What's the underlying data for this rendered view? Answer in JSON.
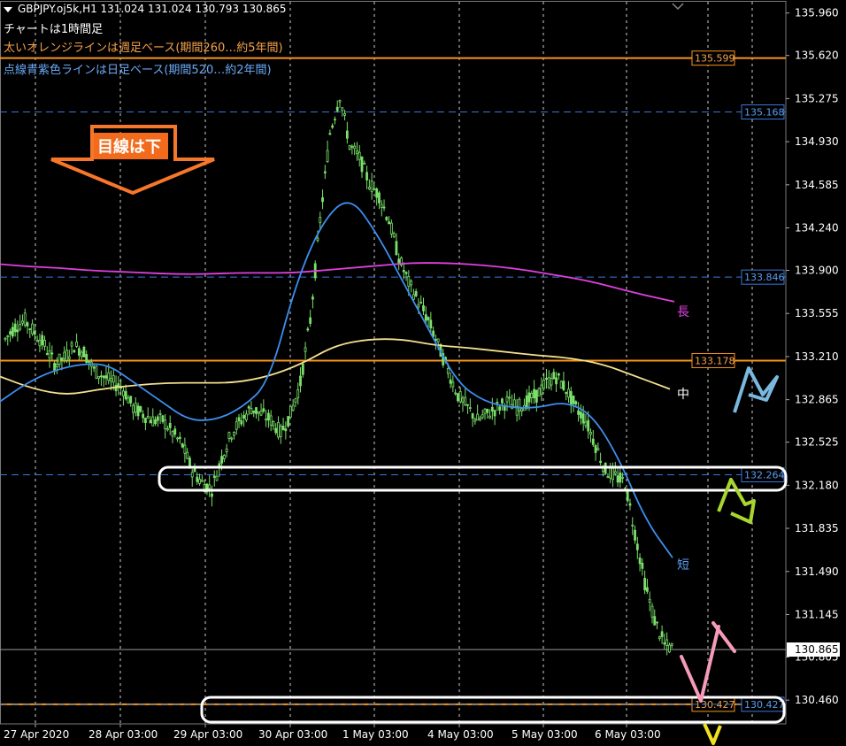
{
  "header": {
    "symbol_line": "GBPJPY.oj5k,H1  131.024 131.024 130.793 130.865",
    "note1": "チャートは1時間足",
    "note2": "太いオレンジラインは週足ベース(期間260…約5年間)",
    "note3": "点線青紫色ラインは日足ベース(期間520…約2年間)"
  },
  "annotations": {
    "arrow_text": "目線は下",
    "long_label": "長",
    "mid_label": "中",
    "short_label": "短"
  },
  "chart_data": {
    "type": "line",
    "symbol": "GBPJPY.oj5k",
    "timeframe": "H1",
    "ohlc_last": {
      "open": 131.024,
      "high": 131.024,
      "low": 130.793,
      "close": 130.865
    },
    "y_ticks": [
      135.96,
      135.62,
      135.275,
      134.93,
      134.585,
      134.24,
      133.9,
      133.555,
      133.21,
      132.865,
      132.525,
      132.18,
      131.835,
      131.49,
      131.145,
      130.805,
      130.46
    ],
    "ylim": [
      130.27,
      136.05
    ],
    "x_labels": [
      "27 Apr 2020",
      "28 Apr 03:00",
      "29 Apr 03:00",
      "30 Apr 03:00",
      "1 May 03:00",
      "4 May 03:00",
      "5 May 03:00",
      "6 May 03:00"
    ],
    "current_price": 130.865,
    "levels": [
      {
        "label": "135.599",
        "value": 135.599,
        "style": "solid",
        "color": "#f7941d"
      },
      {
        "label": "135.168",
        "value": 135.168,
        "style": "dashed",
        "color": "#3a78d8"
      },
      {
        "label": "133.846",
        "value": 133.846,
        "style": "dashed",
        "color": "#3a78d8"
      },
      {
        "label": "133.178",
        "value": 133.178,
        "style": "solid",
        "color": "#f7941d"
      },
      {
        "label": "132.264",
        "value": 132.264,
        "style": "dashed",
        "color": "#3a78d8"
      },
      {
        "label": "130.427",
        "value": 130.427,
        "style": "solid",
        "color": "#f7941d"
      },
      {
        "label": "130.427",
        "value": 130.427,
        "style": "dashed",
        "color": "#3a78d8"
      }
    ],
    "price_series": [
      133.35,
      133.45,
      133.5,
      133.4,
      133.3,
      133.15,
      133.2,
      133.3,
      133.25,
      133.1,
      133.05,
      133.0,
      132.95,
      132.8,
      132.75,
      132.7,
      132.7,
      132.6,
      132.5,
      132.3,
      132.2,
      132.15,
      132.4,
      132.6,
      132.7,
      132.8,
      132.75,
      132.7,
      132.6,
      132.75,
      133.0,
      133.5,
      134.3,
      135.0,
      135.3,
      134.9,
      134.8,
      134.6,
      134.5,
      134.3,
      134.0,
      133.8,
      133.65,
      133.5,
      133.3,
      133.1,
      132.9,
      132.8,
      132.7,
      132.75,
      132.8,
      132.85,
      132.8,
      132.85,
      132.9,
      133.0,
      133.05,
      132.95,
      132.8,
      132.7,
      132.5,
      132.3,
      132.25,
      132.2,
      131.8,
      131.4,
      131.1,
      130.9,
      130.865
    ],
    "series": [
      {
        "name": "長",
        "color": "#e040e0",
        "values": [
          133.95,
          133.93,
          133.92,
          133.9,
          133.89,
          133.88,
          133.87,
          133.87,
          133.88,
          133.88,
          133.88,
          133.9,
          133.92,
          133.94,
          133.96,
          133.96,
          133.95,
          133.93,
          133.9,
          133.86,
          133.82,
          133.76,
          133.7,
          133.65
        ]
      },
      {
        "name": "中",
        "color": "#f4e08c",
        "values": [
          133.05,
          132.95,
          132.9,
          132.95,
          132.98,
          133.0,
          133.0,
          133.0,
          133.05,
          133.15,
          133.3,
          133.35,
          133.35,
          133.3,
          133.28,
          133.25,
          133.22,
          133.2,
          133.15,
          133.05,
          132.95
        ]
      },
      {
        "name": "短",
        "color": "#3d8ef0",
        "values": [
          132.85,
          133.0,
          133.1,
          133.15,
          133.15,
          133.0,
          132.85,
          132.7,
          132.7,
          132.8,
          133.0,
          133.8,
          134.3,
          134.5,
          134.2,
          133.8,
          133.4,
          133.0,
          132.85,
          132.8,
          132.8,
          132.85,
          132.75,
          132.4,
          131.9,
          131.6
        ]
      }
    ]
  }
}
